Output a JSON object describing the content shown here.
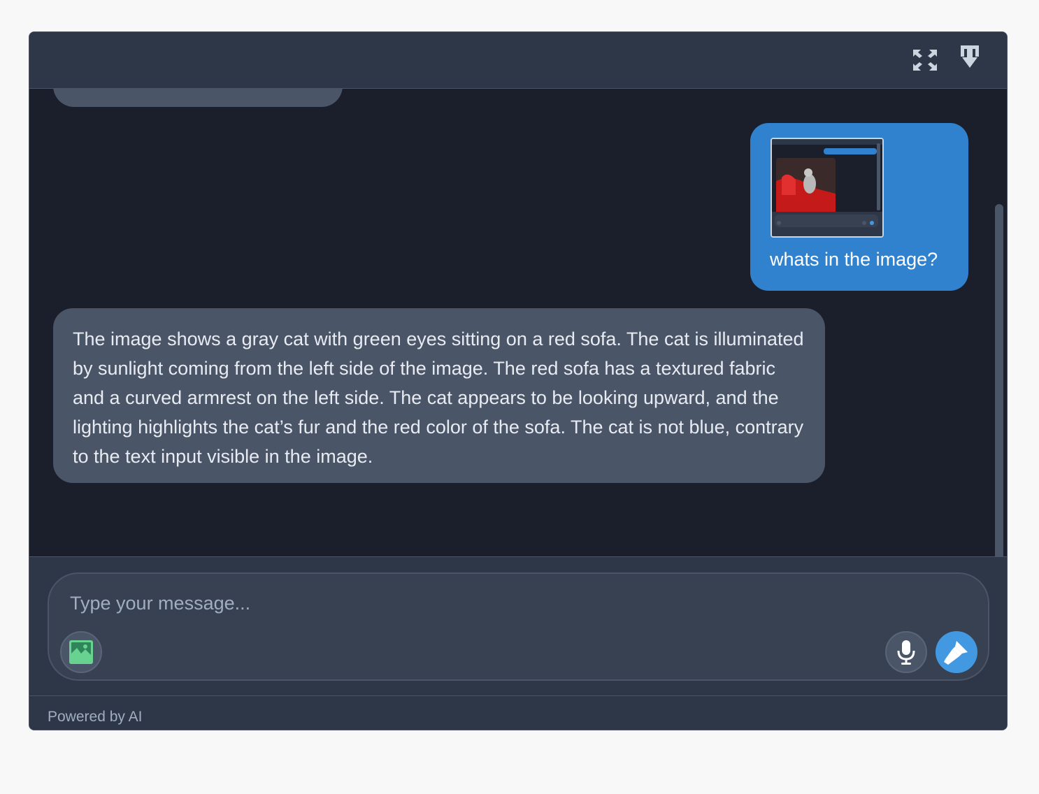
{
  "header": {
    "expand_icon": "expand-icon",
    "download_icon": "download-icon"
  },
  "messages": [
    {
      "role": "user",
      "has_image": true,
      "text": "whats in the image?"
    },
    {
      "role": "assistant",
      "text": "The image shows a gray cat with green eyes sitting on a red sofa. The cat is illuminated by sunlight coming from the left side of the image. The red sofa has a textured fabric and a curved armrest on the left side. The cat appears to be looking upward, and the lighting highlights the cat’s fur and the red color of the sofa. The cat is not blue, contrary to the text input visible in the image."
    }
  ],
  "composer": {
    "placeholder": "Type your message...",
    "value": "",
    "image_button_icon": "image-icon",
    "mic_button_icon": "microphone-icon",
    "send_button_icon": "send-icon"
  },
  "footer": {
    "text": "Powered by AI"
  },
  "colors": {
    "user_bubble": "#3182ce",
    "assistant_bubble": "#4a5568",
    "send_button": "#4299e1",
    "image_icon": "#68d391"
  }
}
